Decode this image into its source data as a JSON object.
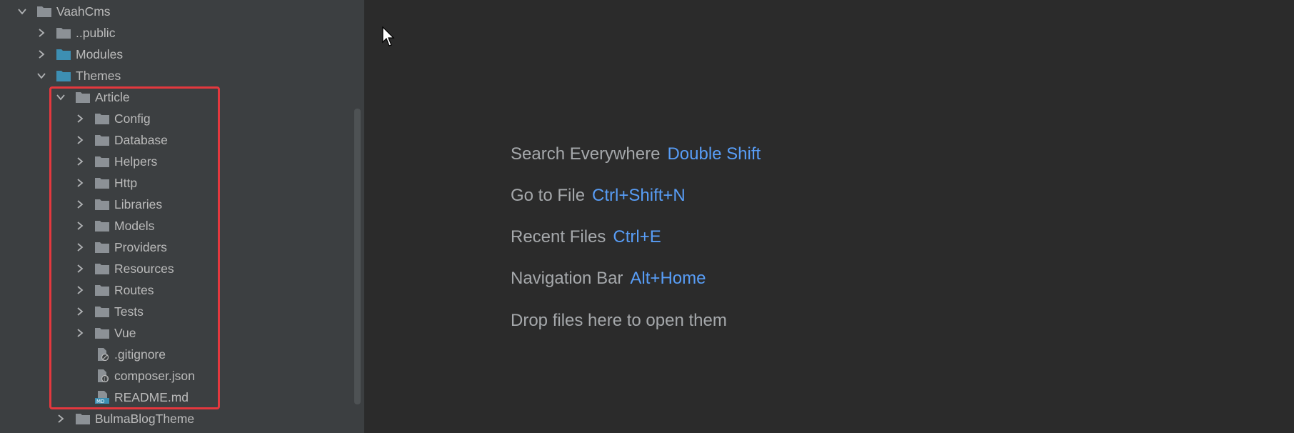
{
  "tree": {
    "items": [
      {
        "label": "VaahCms",
        "depth": 0,
        "expanded": true,
        "kind": "folder",
        "color": "#8c9196"
      },
      {
        "label": "..public",
        "depth": 1,
        "expanded": false,
        "kind": "folder",
        "color": "#8c9196"
      },
      {
        "label": "Modules",
        "depth": 1,
        "expanded": false,
        "kind": "folder",
        "color": "#3d8fb3"
      },
      {
        "label": "Themes",
        "depth": 1,
        "expanded": true,
        "kind": "folder",
        "color": "#3d8fb3"
      },
      {
        "label": "Article",
        "depth": 2,
        "expanded": true,
        "kind": "folder",
        "color": "#8c9196"
      },
      {
        "label": "Config",
        "depth": 3,
        "expanded": false,
        "kind": "folder",
        "color": "#8c9196"
      },
      {
        "label": "Database",
        "depth": 3,
        "expanded": false,
        "kind": "folder",
        "color": "#8c9196"
      },
      {
        "label": "Helpers",
        "depth": 3,
        "expanded": false,
        "kind": "folder",
        "color": "#8c9196"
      },
      {
        "label": "Http",
        "depth": 3,
        "expanded": false,
        "kind": "folder",
        "color": "#8c9196"
      },
      {
        "label": "Libraries",
        "depth": 3,
        "expanded": false,
        "kind": "folder",
        "color": "#8c9196"
      },
      {
        "label": "Models",
        "depth": 3,
        "expanded": false,
        "kind": "folder",
        "color": "#8c9196"
      },
      {
        "label": "Providers",
        "depth": 3,
        "expanded": false,
        "kind": "folder",
        "color": "#8c9196"
      },
      {
        "label": "Resources",
        "depth": 3,
        "expanded": false,
        "kind": "folder",
        "color": "#8c9196"
      },
      {
        "label": "Routes",
        "depth": 3,
        "expanded": false,
        "kind": "folder",
        "color": "#8c9196"
      },
      {
        "label": "Tests",
        "depth": 3,
        "expanded": false,
        "kind": "folder",
        "color": "#8c9196"
      },
      {
        "label": "Vue",
        "depth": 3,
        "expanded": false,
        "kind": "folder",
        "color": "#8c9196"
      },
      {
        "label": ".gitignore",
        "depth": 3,
        "expanded": null,
        "kind": "gitignore-file",
        "color": "#8c9196"
      },
      {
        "label": "composer.json",
        "depth": 3,
        "expanded": null,
        "kind": "json-file",
        "color": "#8c9196"
      },
      {
        "label": "README.md",
        "depth": 3,
        "expanded": null,
        "kind": "md-file",
        "color": "#8c9196"
      },
      {
        "label": "BulmaBlogTheme",
        "depth": 2,
        "expanded": false,
        "kind": "folder",
        "color": "#8c9196"
      }
    ]
  },
  "editor": {
    "hints": [
      {
        "text": "Search Everywhere",
        "key": "Double Shift"
      },
      {
        "text": "Go to File",
        "key": "Ctrl+Shift+N"
      },
      {
        "text": "Recent Files",
        "key": "Ctrl+E"
      },
      {
        "text": "Navigation Bar",
        "key": "Alt+Home"
      },
      {
        "text": "Drop files here to open them",
        "key": ""
      }
    ]
  },
  "colors": {
    "highlight": "#e4383e",
    "shortcut": "#589df6"
  }
}
